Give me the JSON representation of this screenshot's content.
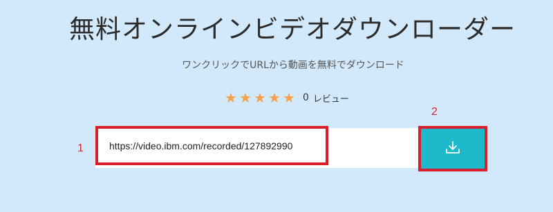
{
  "header": {
    "title": "無料オンラインビデオダウンローダー",
    "subtitle": "ワンクリックでURLから動画を無料でダウンロード"
  },
  "rating": {
    "stars": 5,
    "count": "0",
    "label": "レビュー",
    "star_color": "#f5a04c"
  },
  "form": {
    "url_value": "https://video.ibm.com/recorded/127892990",
    "button_icon": "download-icon",
    "button_color": "#1eb8cb"
  },
  "annotations": {
    "marker_1": "1",
    "marker_2": "2",
    "highlight_color": "#d81f2a"
  }
}
